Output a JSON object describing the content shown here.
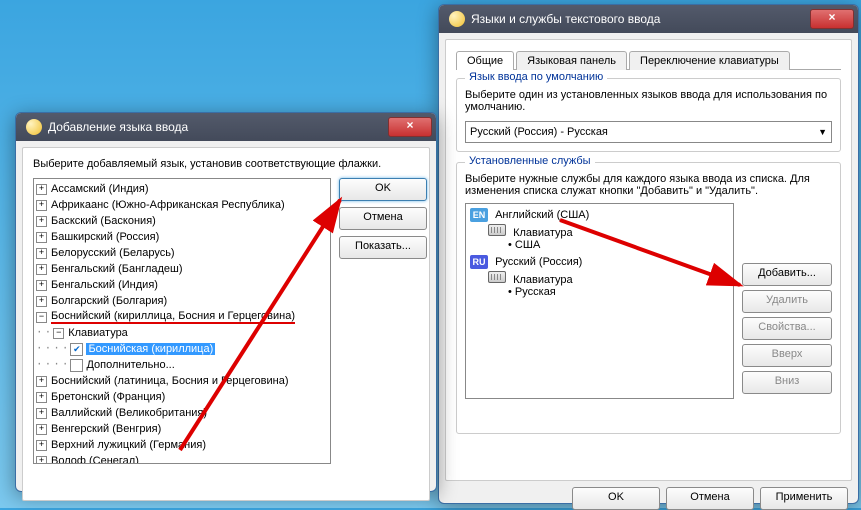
{
  "win1": {
    "title": "Добавление языка ввода",
    "instruction": "Выберите добавляемый язык, установив соответствующие флажки.",
    "ok": "OK",
    "cancel": "Отмена",
    "show": "Показать...",
    "langs": [
      "Ассамский (Индия)",
      "Африкаанс (Южно-Африканская Республика)",
      "Баскский (Баскония)",
      "Башкирский (Россия)",
      "Белорусский (Беларусь)",
      "Бенгальский (Бангладеш)",
      "Бенгальский (Индия)",
      "Болгарский (Болгария)"
    ],
    "expanded": "Боснийский (кириллица, Босния и Герцеговина)",
    "kbGroup": "Клавиатура",
    "selectedKb": "Боснийская (кириллица)",
    "more": "Дополнительно...",
    "after": [
      "Боснийский (латиница, Босния и Герцеговина)",
      "Бретонский (Франция)",
      "Валлийский (Великобритания)",
      "Венгерский (Венгрия)",
      "Верхний лужицкий (Германия)",
      "Волоф (Сенегал)"
    ]
  },
  "win2": {
    "title": "Языки и службы текстового ввода",
    "tabs": [
      "Общие",
      "Языковая панель",
      "Переключение клавиатуры"
    ],
    "g1": {
      "title": "Язык ввода по умолчанию",
      "text": "Выберите один из установленных языков ввода для использования по умолчанию.",
      "combo": "Русский (Россия) - Русская"
    },
    "g2": {
      "title": "Установленные службы",
      "text": "Выберите нужные службы для каждого языка ввода из списка. Для изменения списка служат кнопки \"Добавить\" и \"Удалить\"."
    },
    "svc": [
      {
        "badge": "EN",
        "color": "#4aa0e0",
        "name": "Английский (США)",
        "kb": "Клавиатура",
        "layout": "США"
      },
      {
        "badge": "RU",
        "color": "#4a5ae0",
        "name": "Русский (Россия)",
        "kb": "Клавиатура",
        "layout": "Русская"
      }
    ],
    "btns": {
      "add": "Добавить...",
      "del": "Удалить",
      "prop": "Свойства...",
      "up": "Вверх",
      "down": "Вниз"
    },
    "bottom": {
      "ok": "OK",
      "cancel": "Отмена",
      "apply": "Применить"
    }
  }
}
